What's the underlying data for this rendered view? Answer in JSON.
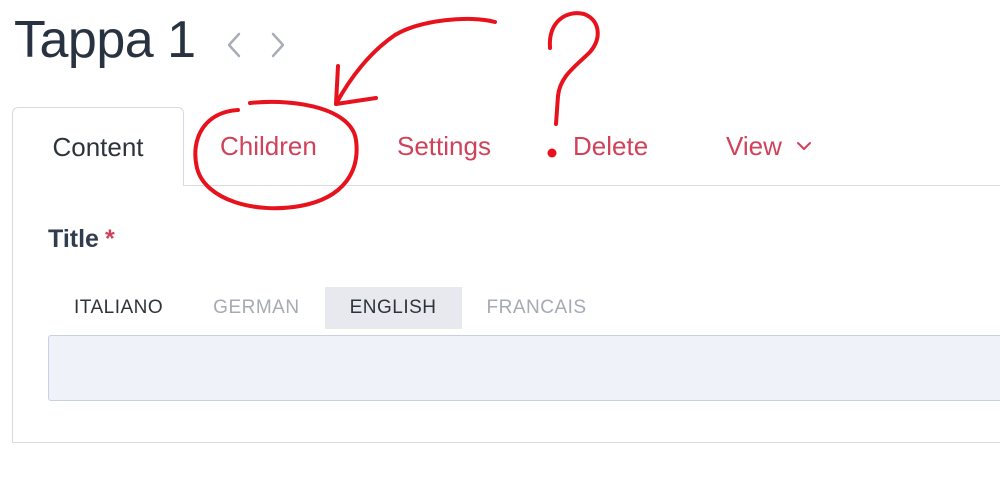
{
  "page": {
    "title": "Tappa 1",
    "pager": {
      "prev_icon": "chevron-left-icon",
      "next_icon": "chevron-right-icon"
    }
  },
  "tabs": [
    {
      "label": "Content",
      "active": true
    },
    {
      "label": "Children"
    },
    {
      "label": "Settings"
    },
    {
      "label": "Delete"
    },
    {
      "label": "View",
      "icon": "chevron-down-icon"
    }
  ],
  "field": {
    "label": "Title",
    "required_mark": "*",
    "languages": [
      {
        "label": "ITALIANO",
        "state": "current"
      },
      {
        "label": "GERMAN",
        "state": "inactive"
      },
      {
        "label": "ENGLISH",
        "state": "selected"
      },
      {
        "label": "FRANCAIS",
        "state": "inactive"
      }
    ],
    "value": ""
  },
  "colors": {
    "accent": "#d0425a",
    "title_text": "#283240",
    "border": "#d5dae3",
    "input_bg": "#eff2f8",
    "annotation": "#e8121d"
  }
}
